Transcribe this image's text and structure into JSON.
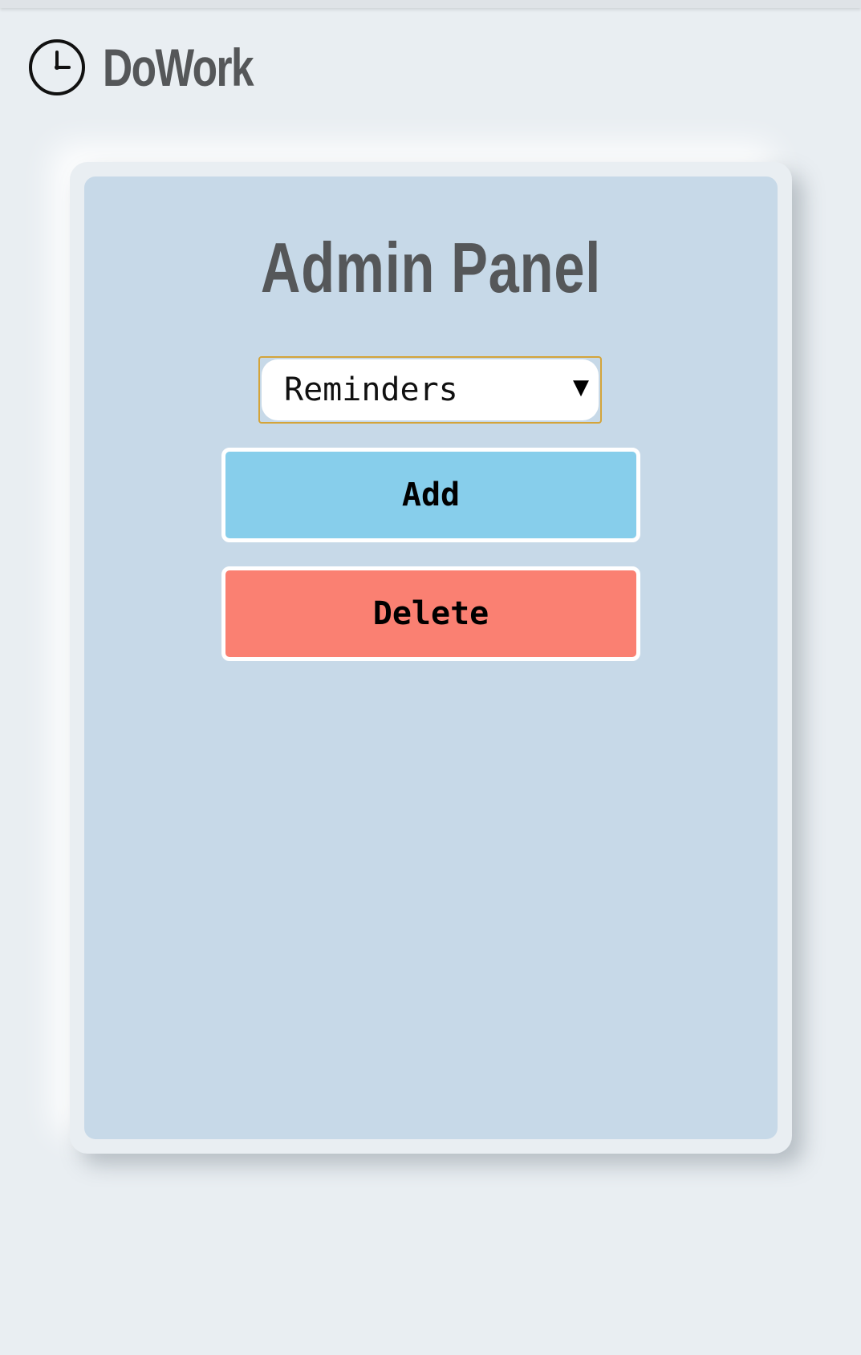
{
  "app": {
    "name": "DoWork",
    "logo_icon": "clock-icon"
  },
  "panel": {
    "title": "Admin Panel",
    "select": {
      "value": "Reminders",
      "arrow": "▼"
    },
    "add_label": "Add",
    "delete_label": "Delete"
  },
  "colors": {
    "background": "#e9eef2",
    "panel_bg": "#c7d9e8",
    "title_text": "#555759",
    "add_button": "#87ceeb",
    "delete_button": "#fa8072",
    "select_focus_border": "#d4a43a"
  }
}
